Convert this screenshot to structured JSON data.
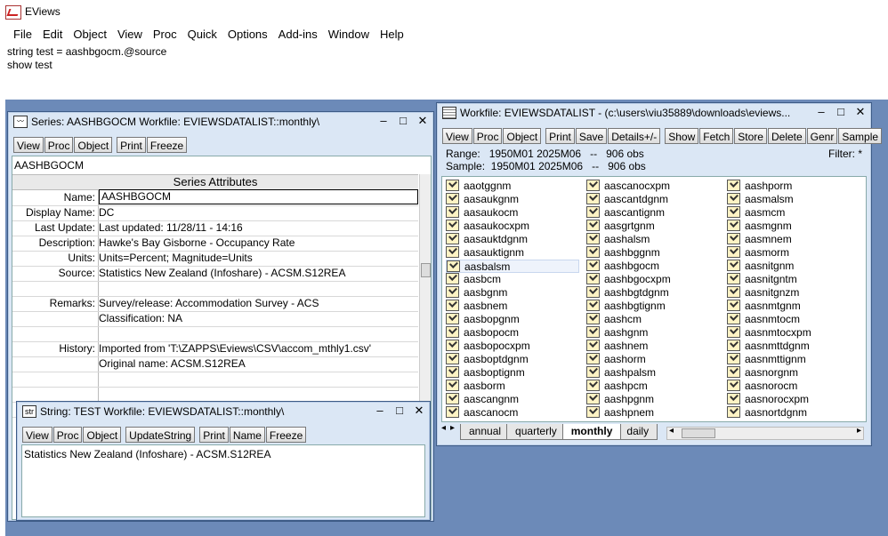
{
  "app": {
    "title": "EViews"
  },
  "menu": [
    "File",
    "Edit",
    "Object",
    "View",
    "Proc",
    "Quick",
    "Options",
    "Add-ins",
    "Window",
    "Help"
  ],
  "command": [
    "string test = aashbgocm.@source",
    "show test"
  ],
  "series_window": {
    "title": "Series: AASHBGOCM   Workfile: EVIEWSDATALIST::monthly\\",
    "toolbar": [
      "View",
      "Proc",
      "Object",
      "Print",
      "Freeze"
    ],
    "name_line": "AASHBGOCM",
    "header": "Series Attributes",
    "rows": [
      {
        "k": "Name:",
        "v": "AASHBGOCM"
      },
      {
        "k": "Display Name:",
        "v": "DC"
      },
      {
        "k": "Last Update:",
        "v": "Last updated: 11/28/11 - 14:16"
      },
      {
        "k": "Description:",
        "v": "Hawke's Bay Gisborne - Occupancy Rate"
      },
      {
        "k": "Units:",
        "v": "Units=Percent; Magnitude=Units"
      },
      {
        "k": "Source:",
        "v": "Statistics New Zealand (Infoshare) - ACSM.S12REA"
      },
      {
        "k": "",
        "v": ""
      },
      {
        "k": "Remarks:",
        "v": "Survey/release: Accommodation Survey - ACS"
      },
      {
        "k": "",
        "v": "Classification: NA"
      },
      {
        "k": "",
        "v": ""
      },
      {
        "k": "History:",
        "v": "Imported from 'T:\\ZAPPS\\Eviews\\CSV\\accom_mthly1.csv'"
      },
      {
        "k": "",
        "v": "Original name: ACSM.S12REA"
      }
    ]
  },
  "string_window": {
    "icon": "str",
    "title": "String: TEST   Workfile: EVIEWSDATALIST::monthly\\",
    "toolbar": [
      "View",
      "Proc",
      "Object",
      "UpdateString",
      "Print",
      "Name",
      "Freeze"
    ],
    "content": "Statistics New Zealand (Infoshare) - ACSM.S12REA"
  },
  "workfile_window": {
    "title": "Workfile: EVIEWSDATALIST - (c:\\users\\viu35889\\downloads\\eviews...",
    "toolbar": [
      "View",
      "Proc",
      "Object",
      "Print",
      "Save",
      "Details+/-",
      "Show",
      "Fetch",
      "Store",
      "Delete",
      "Genr",
      "Sample"
    ],
    "range": "Range:   1950M01 2025M06   --   906 obs",
    "sample": "Sample:  1950M01 2025M06   --   906 obs",
    "filter": "Filter: *",
    "col1": [
      "aaotggnm",
      "aasaukgnm",
      "aasaukocm",
      "aasaukocxpm",
      "aasauktdgnm",
      "aasauktignm",
      "aasbalsm",
      "aasbcm",
      "aasbgnm",
      "aasbnem",
      "aasbopgnm",
      "aasbopocm",
      "aasbopocxpm",
      "aasboptdgnm",
      "aasboptignm",
      "aasborm",
      "aascangnm",
      "aascanocm"
    ],
    "col2": [
      "aascanocxpm",
      "aascantdgnm",
      "aascantignm",
      "aasgrtgnm",
      "aashalsm",
      "aashbggnm",
      "aashbgocm",
      "aashbgocxpm",
      "aashbgtdgnm",
      "aashbgtignm",
      "aashcm",
      "aashgnm",
      "aashnem",
      "aashorm",
      "aashpalsm",
      "aashpcm",
      "aashpgnm",
      "aashpnem"
    ],
    "col3": [
      "aashporm",
      "aasmalsm",
      "aasmcm",
      "aasmgnm",
      "aasmnem",
      "aasmorm",
      "aasnitgnm",
      "aasnitgntm",
      "aasnitgnzm",
      "aasnmtgnm",
      "aasnmtocm",
      "aasnmtocxpm",
      "aasnmttdgnm",
      "aasnmttignm",
      "aasnorgnm",
      "aasnorocm",
      "aasnorocxpm",
      "aasnortdgnm"
    ],
    "tabs": [
      "annual",
      "quarterly",
      "monthly",
      "daily"
    ],
    "active_tab": "monthly"
  },
  "colors": {
    "desktop": "#6c8ab8",
    "title_bg": "#dbe7f5",
    "checkbox": "#fff3c4"
  }
}
